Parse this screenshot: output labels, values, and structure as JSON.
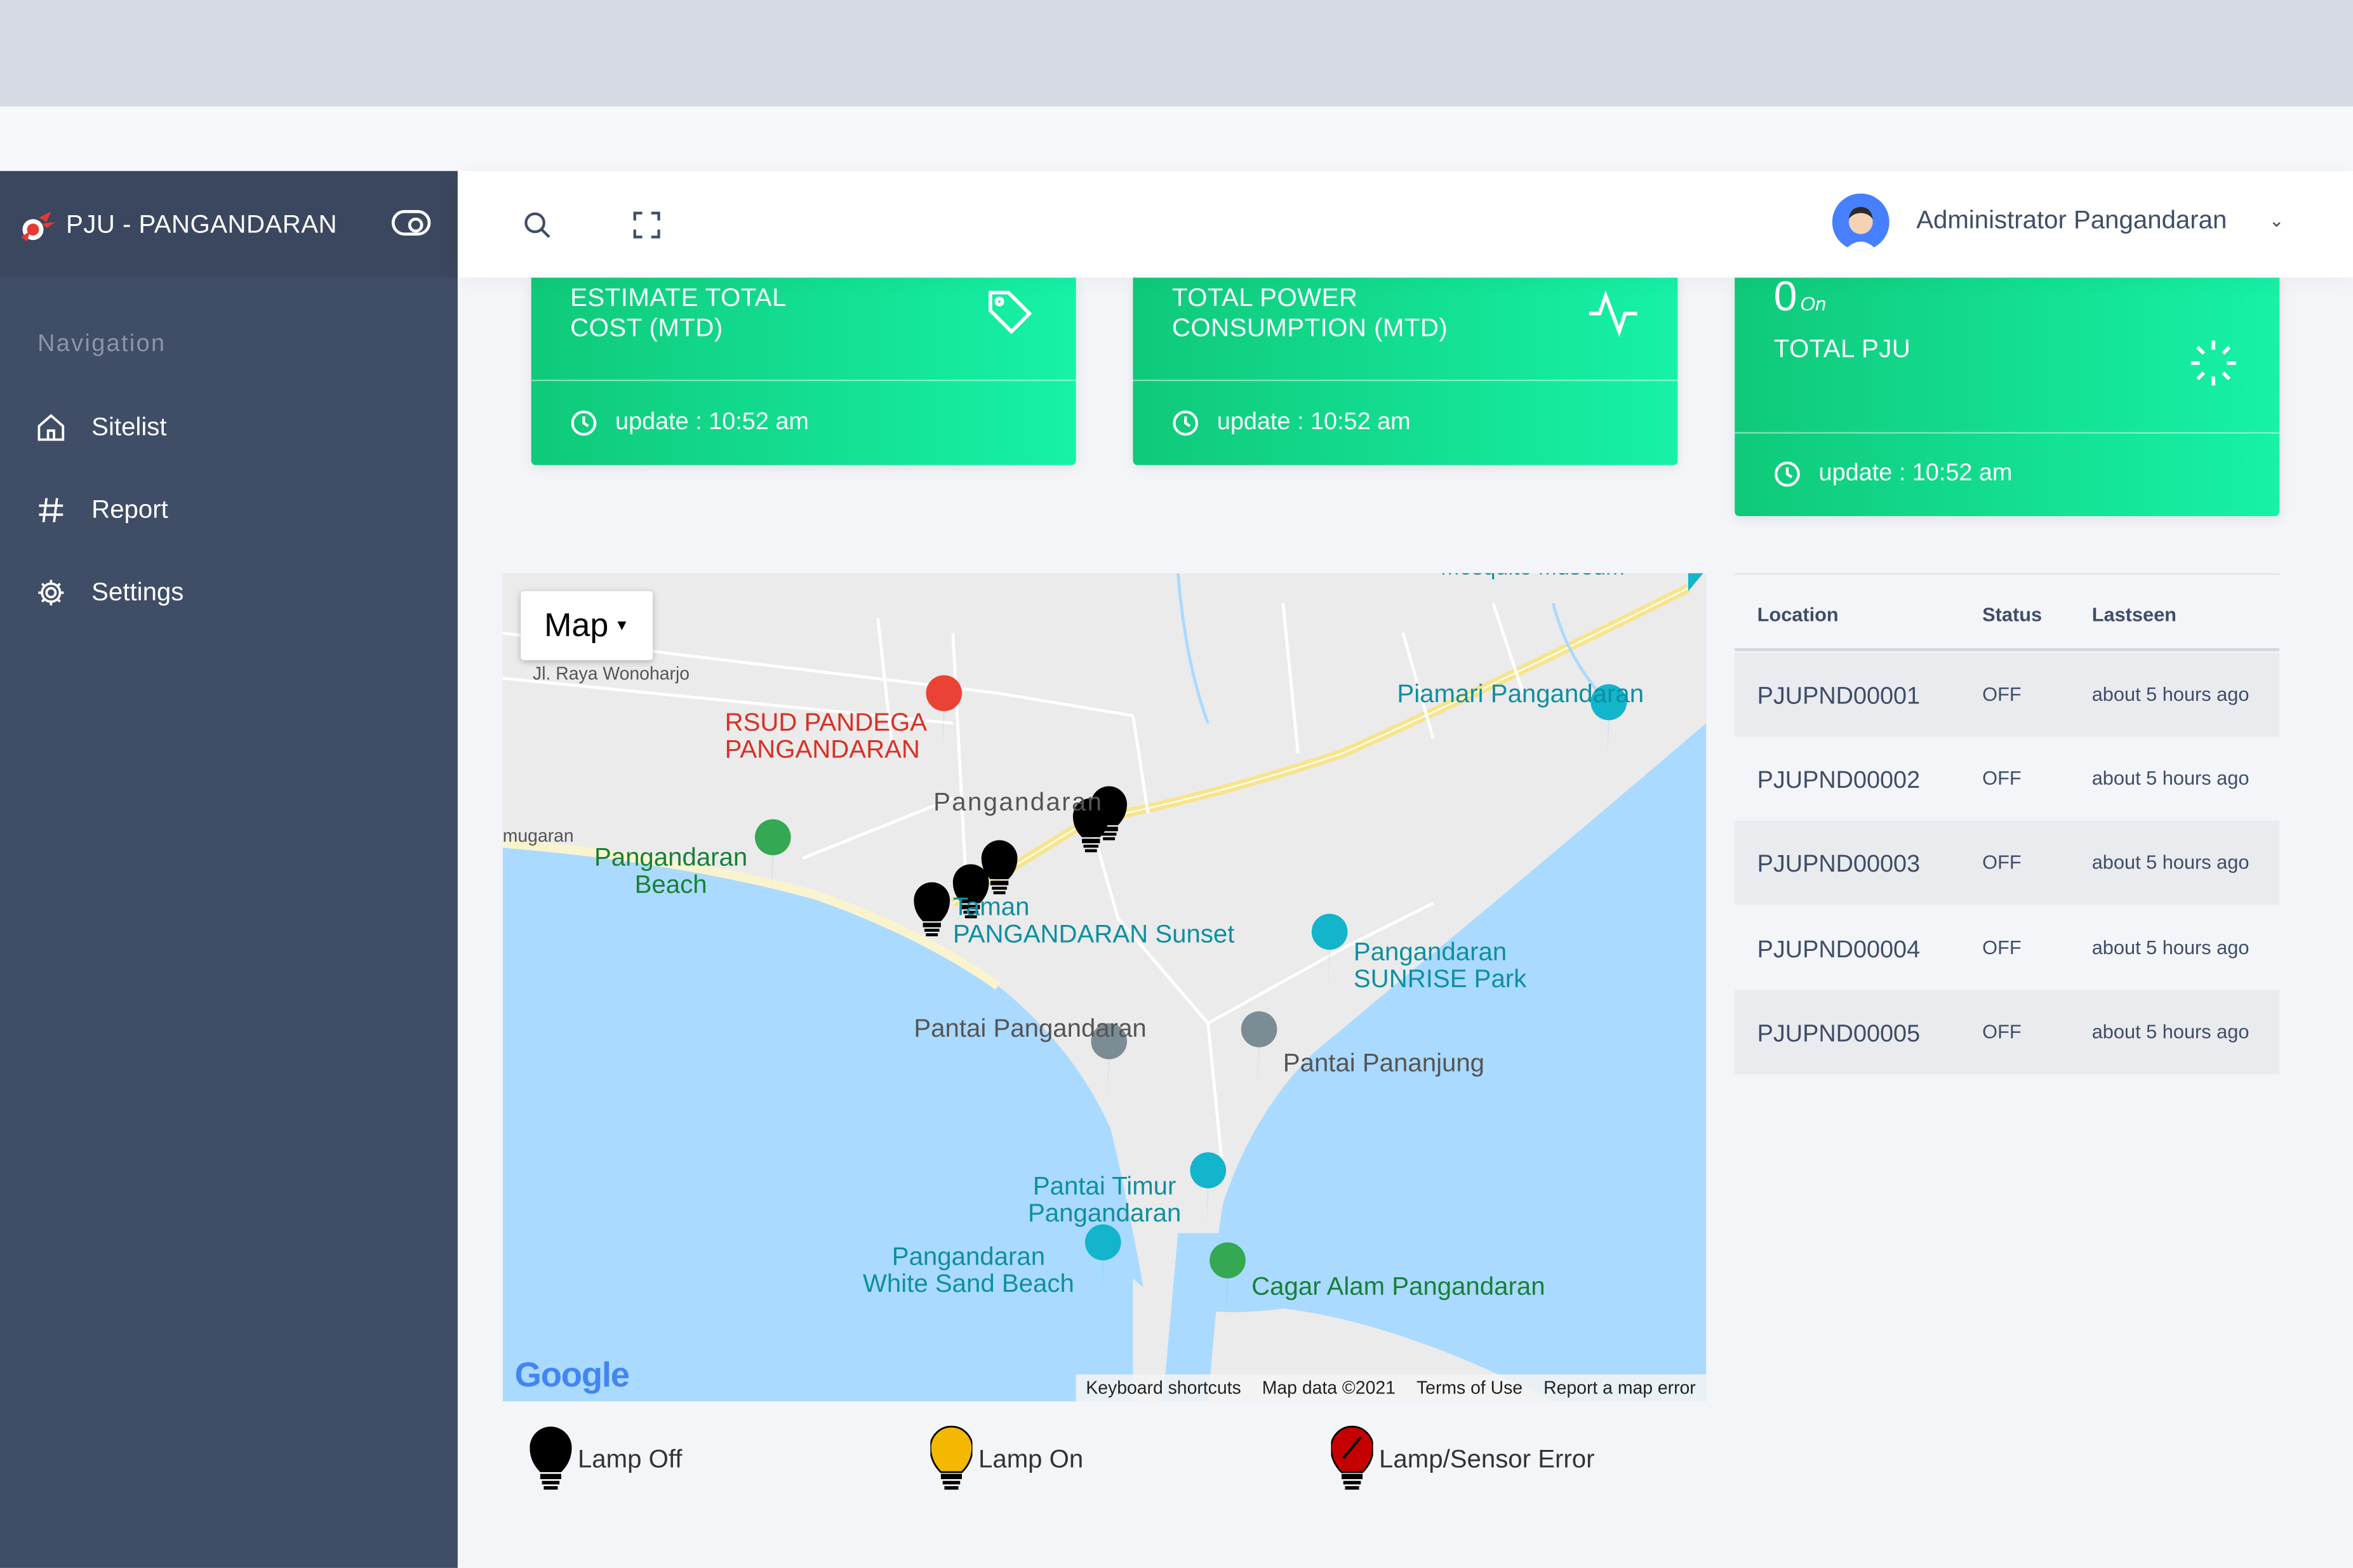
{
  "app": {
    "brand": "PJU - PANGANDARAN"
  },
  "sidebar": {
    "caption": "Navigation",
    "items": [
      {
        "label": "Sitelist",
        "icon": "home-icon"
      },
      {
        "label": "Report",
        "icon": "hash-icon"
      },
      {
        "label": "Settings",
        "icon": "gear-icon"
      }
    ]
  },
  "header": {
    "user_name": "Administrator Pangandaran"
  },
  "cards": {
    "cost": {
      "title_line1": "ESTIMATE TOTAL",
      "title_line2": "COST (MTD)",
      "update": "update : 10:52 am"
    },
    "power": {
      "title_line1": "TOTAL POWER",
      "title_line2": "CONSUMPTION (MTD)",
      "update": "update : 10:52 am"
    },
    "pju": {
      "count": "0",
      "count_suffix": "On",
      "title": "TOTAL PJU",
      "update": "update : 10:52 am"
    }
  },
  "map": {
    "type_button": "Map",
    "labels": {
      "museum": "Mosquito Museum",
      "wonoharjo": "Jl. Raya Wonoharjo",
      "hospital_1": "RSUD PANDEGA",
      "hospital_2": "PANGANDARAN",
      "piamari": "Piamari Pangandaran",
      "town": "Pangandaran",
      "mugaran": "mugaran",
      "beach_1": "Pangandaran",
      "beach_2": "Beach",
      "taman_1": "Taman",
      "taman_2": "PANGANDARAN Sunset",
      "sunrise_1": "Pangandaran",
      "sunrise_2": "SUNRISE Park",
      "pantai": "Pantai Pangandaran",
      "pananjung": "Pantai Pananjung",
      "timur_1": "Pantai Timur",
      "timur_2": "Pangandaran",
      "white_1": "Pangandaran",
      "white_2": "White Sand Beach",
      "cagar": "Cagar Alam Pangandaran"
    },
    "footer": [
      "Keyboard shortcuts",
      "Map data ©2021",
      "Terms of Use",
      "Report a map error"
    ],
    "google": "Google"
  },
  "legend": [
    {
      "label": "Lamp Off",
      "color": "#000000"
    },
    {
      "label": "Lamp On",
      "color": "#f5b800"
    },
    {
      "label": "Lamp/Sensor Error",
      "color": "#c40000"
    }
  ],
  "table": {
    "headers": [
      "Location",
      "Status",
      "Lastseen"
    ],
    "rows": [
      [
        "PJUPND00001",
        "OFF",
        "about 5 hours ago"
      ],
      [
        "PJUPND00002",
        "OFF",
        "about 5 hours ago"
      ],
      [
        "PJUPND00003",
        "OFF",
        "about 5 hours ago"
      ],
      [
        "PJUPND00004",
        "OFF",
        "about 5 hours ago"
      ],
      [
        "PJUPND00005",
        "OFF",
        "about 5 hours ago"
      ]
    ]
  },
  "colors": {
    "sidebar": "#3f4d67",
    "card_gradient_start": "#10c97a",
    "card_gradient_end": "#16f2a6",
    "water": "#aadaff"
  }
}
